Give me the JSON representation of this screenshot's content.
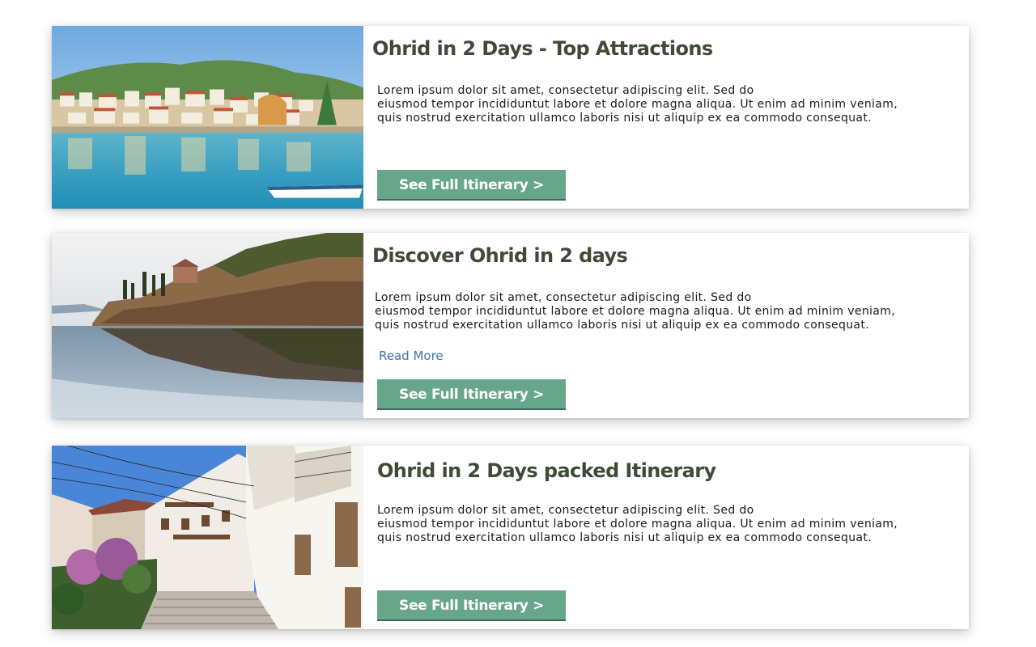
{
  "cards": [
    {
      "title": "Ohrid in 2 Days - Top Attractions",
      "text": [
        "Lorem ipsum dolor sit amet, consectetur adipiscing elit. Sed do",
        "eiusmod tempor incididuntut labore et dolore magna aliqua. Ut enim ad minim veniam,",
        "quis nostrud exercitation ullamco laboris nisi ut aliquip ex ea commodo consequat."
      ],
      "button": "See Full Itinerary >",
      "photo": "ohrid-old-town-lakeside-photo"
    },
    {
      "title": "Discover Ohrid in 2 days",
      "text": [
        "Lorem ipsum dolor sit amet, consectetur adipiscing elit. Sed do",
        "eiusmod tempor incididuntut labore et dolore magna aliqua. Ut enim ad minim veniam,",
        "quis nostrud exercitation ullamco laboris nisi ut aliquip ex ea commodo consequat."
      ],
      "link": "Read More",
      "button": "See Full Itinerary >",
      "photo": "church-on-cliff-photo"
    },
    {
      "title": "Ohrid in 2 Days packed Itinerary",
      "text": [
        "Lorem ipsum dolor sit amet, consectetur adipiscing elit. Sed do",
        "eiusmod tempor incididuntut labore et dolore magna aliqua. Ut enim ad minim veniam,",
        "quis nostrud exercitation ullamco laboris nisi ut aliquip ex ea commodo consequat."
      ],
      "button": "See Full Itinerary >",
      "photo": "old-town-street-photo"
    }
  ],
  "colors": {
    "title": "#3f4b37",
    "button_bg": "#67a68a",
    "link": "#4e7ea6"
  }
}
